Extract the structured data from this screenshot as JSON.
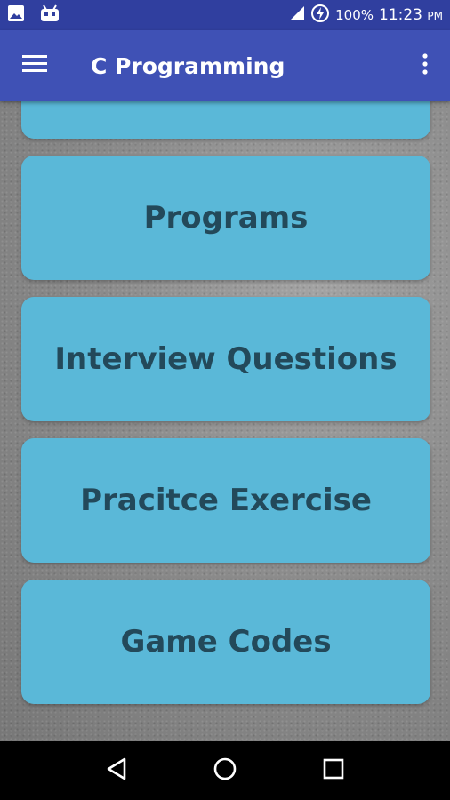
{
  "status_bar": {
    "battery_text": "100%",
    "time": "11:23",
    "time_suffix": "PM",
    "icons": [
      "image-icon",
      "android-debug-icon",
      "cell-signal-icon",
      "battery-charging-icon"
    ]
  },
  "app_bar": {
    "title": "C Programming",
    "icons": [
      "hamburger-menu-icon",
      "overflow-menu-icon"
    ],
    "color": "#3f51b5"
  },
  "cards": [
    {
      "label": ""
    },
    {
      "label": "Programs"
    },
    {
      "label": "Interview Questions"
    },
    {
      "label": "Pracitce Exercise"
    },
    {
      "label": "Game Codes"
    }
  ],
  "card_color": "#5ab8d8",
  "card_text_color": "#23495a",
  "nav_bar": {
    "icons": [
      "back-icon",
      "home-icon",
      "recents-icon"
    ]
  }
}
